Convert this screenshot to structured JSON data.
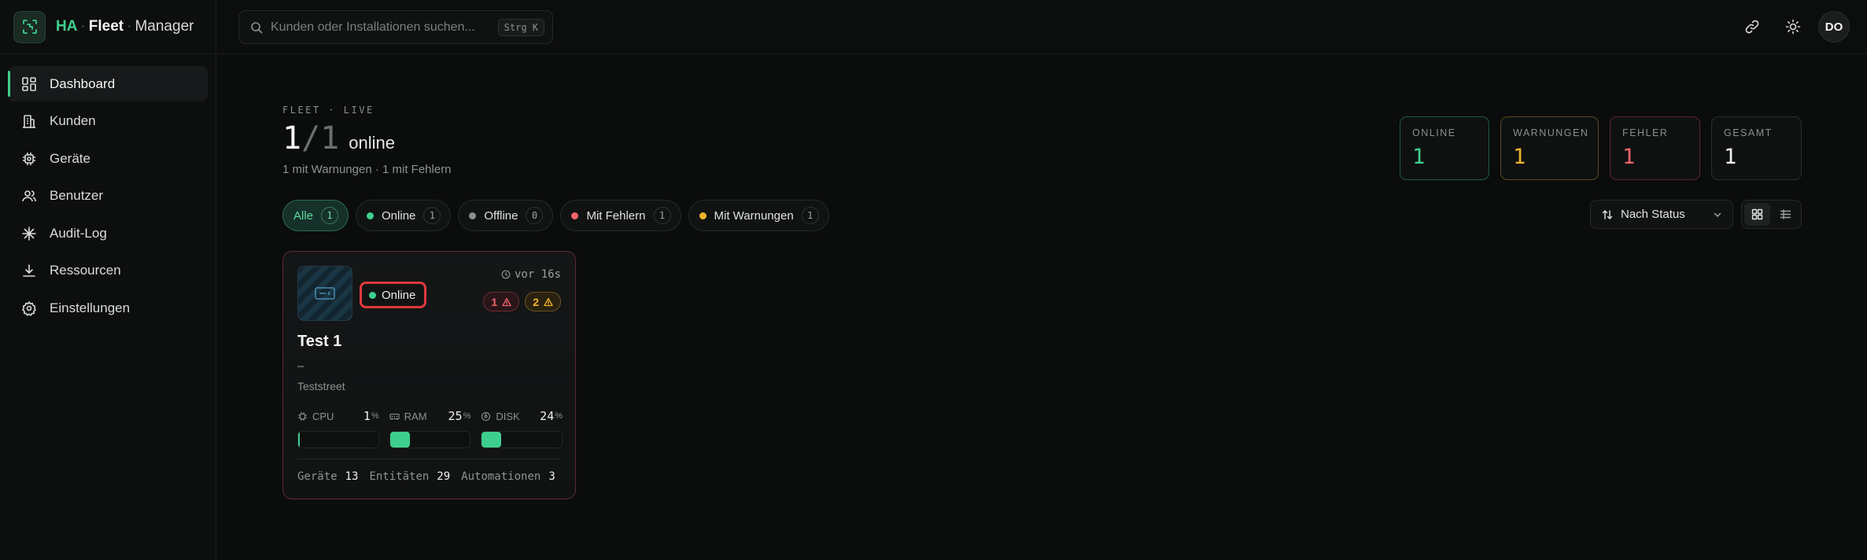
{
  "brand": {
    "ha": "HA",
    "sep": "·",
    "fleet": "Fleet",
    "manager": "Manager",
    "accent": "#3ecf8e"
  },
  "sidebar": {
    "items": [
      {
        "label": "Dashboard",
        "icon": "dashboard-icon",
        "active": true
      },
      {
        "label": "Kunden",
        "icon": "building-icon"
      },
      {
        "label": "Geräte",
        "icon": "chip-icon"
      },
      {
        "label": "Benutzer",
        "icon": "users-icon"
      },
      {
        "label": "Audit-Log",
        "icon": "asterisk-icon"
      },
      {
        "label": "Ressourcen",
        "icon": "download-icon"
      },
      {
        "label": "Einstellungen",
        "icon": "settings-icon"
      }
    ]
  },
  "topbar": {
    "search_placeholder": "Kunden oder Installationen suchen...",
    "search_shortcut": "Strg K",
    "avatar_initials": "DO"
  },
  "overview": {
    "eyebrow": "FLEET · LIVE",
    "online": "1",
    "slash": "/",
    "total": "1",
    "word": "online",
    "subline": "1 mit Warnungen · 1 mit Fehlern"
  },
  "stats": [
    {
      "label": "ONLINE",
      "value": "1",
      "color": "#3ecf8e",
      "border": "#1f5a42"
    },
    {
      "label": "WARNUNGEN",
      "value": "1",
      "color": "#f0b429",
      "border": "#5a4820"
    },
    {
      "label": "FEHLER",
      "value": "1",
      "color": "#f0636b",
      "border": "#5a2730"
    },
    {
      "label": "GESAMT",
      "value": "1",
      "color": "#f3f5f4",
      "border": "#2a2e2d"
    }
  ],
  "filters": [
    {
      "label": "Alle",
      "count": "1",
      "active": true
    },
    {
      "label": "Online",
      "count": "1",
      "dot": "#3ecf8e"
    },
    {
      "label": "Offline",
      "count": "0",
      "dot": "#8a8f8d"
    },
    {
      "label": "Mit Fehlern",
      "count": "1",
      "dot": "#f0636b"
    },
    {
      "label": "Mit Warnungen",
      "count": "1",
      "dot": "#f0b429"
    }
  ],
  "sort": {
    "label": "Nach Status"
  },
  "card": {
    "status": "Online",
    "ago": "vor 16s",
    "errors": "1",
    "warnings": "2",
    "title": "Test 1",
    "dash": "–",
    "address": "Teststreet",
    "metrics": [
      {
        "label": "CPU",
        "value": "1",
        "unit": "%",
        "percent": 1
      },
      {
        "label": "RAM",
        "value": "25",
        "unit": "%",
        "percent": 25
      },
      {
        "label": "DISK",
        "value": "24",
        "unit": "%",
        "percent": 24
      }
    ],
    "footer": [
      {
        "label": "Geräte",
        "value": "13"
      },
      {
        "label": "Entitäten",
        "value": "29"
      },
      {
        "label": "Automationen",
        "value": "3"
      }
    ]
  }
}
